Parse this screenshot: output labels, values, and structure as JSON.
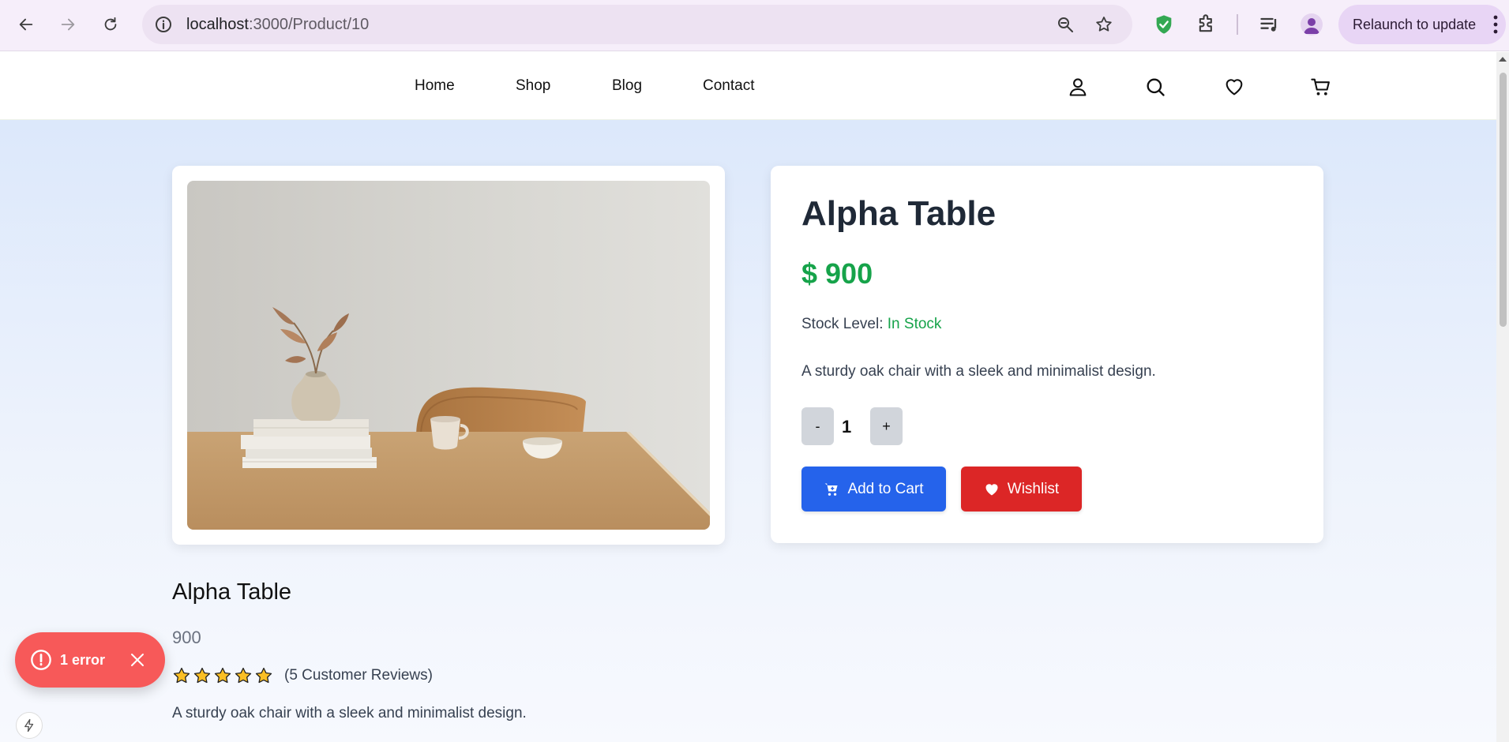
{
  "browser": {
    "url_host": "localhost",
    "url_path": ":3000/Product/10",
    "relaunch_label": "Relaunch to update"
  },
  "site_nav": {
    "items": [
      {
        "label": "Home"
      },
      {
        "label": "Shop"
      },
      {
        "label": "Blog"
      },
      {
        "label": "Contact"
      }
    ],
    "icons": [
      "user-icon",
      "search-icon",
      "heart-icon",
      "cart-icon"
    ]
  },
  "product": {
    "name": "Alpha Table",
    "price_display": "$ 900",
    "stock_label": "Stock Level:",
    "stock_status": "In Stock",
    "description": "A sturdy oak chair with a sleek and minimalist design.",
    "quantity": "1",
    "decrement_label": "-",
    "increment_label": "+",
    "add_to_cart_label": "Add to Cart",
    "wishlist_label": "Wishlist"
  },
  "details": {
    "title": "Alpha Table",
    "price": "900",
    "rating": 5,
    "rating_max": 5,
    "reviews_label": "(5 Customer Reviews)",
    "description": "A sturdy oak chair with a sleek and minimalist design."
  },
  "error_toast": {
    "label": "1 error"
  },
  "colors": {
    "price_green": "#16a34a",
    "cart_blue": "#2563eb",
    "wishlist_red": "#dc2626",
    "toast_red": "#f75959",
    "star_yellow": "#fbbf24"
  }
}
